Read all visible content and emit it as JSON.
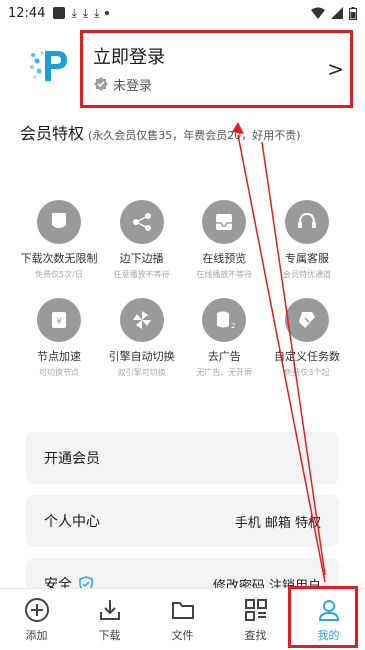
{
  "status_bar": {
    "time": "12:44"
  },
  "login": {
    "title": "立即登录",
    "status": "未登录"
  },
  "privileges": {
    "title": "会员特权",
    "subtitle": "(永久会员仅售35，年费会员20，好用不贵)",
    "items": [
      {
        "name": "下载次数无限制",
        "desc": "免费仅5次/日",
        "icon": "download-limit-icon"
      },
      {
        "name": "边下边播",
        "desc": "任意播放不等待",
        "icon": "share-play-icon"
      },
      {
        "name": "在线预览",
        "desc": "在线播放不等待",
        "icon": "preview-icon"
      },
      {
        "name": "专属客服",
        "desc": "会员特优通道",
        "icon": "headset-icon"
      },
      {
        "name": "节点加速",
        "desc": "可切换节点",
        "icon": "node-speed-icon"
      },
      {
        "name": "引擎自动切换",
        "desc": "双引擎可切换",
        "icon": "engine-switch-icon"
      },
      {
        "name": "去广告",
        "desc": "无广告、无开屏",
        "icon": "no-ads-icon"
      },
      {
        "name": "自定义任务数",
        "desc": "免费仅3个起",
        "icon": "custom-task-icon"
      }
    ]
  },
  "menu": {
    "vip": {
      "label": "开通会员"
    },
    "personal": {
      "label": "个人中心",
      "right": "手机 邮箱 特权"
    },
    "security": {
      "label": "安全",
      "right": "修改密码 注销用户"
    }
  },
  "bottom_nav": {
    "tabs": [
      {
        "label": "添加",
        "icon": "plus-circle-icon"
      },
      {
        "label": "下载",
        "icon": "download-icon"
      },
      {
        "label": "文件",
        "icon": "folder-icon"
      },
      {
        "label": "查找",
        "icon": "grid-search-icon"
      },
      {
        "label": "我的",
        "icon": "user-icon",
        "active": true
      }
    ]
  },
  "colors": {
    "accent": "#2aa8e0",
    "annotation": "#e02020",
    "icon_bg": "#9a9a9a"
  }
}
